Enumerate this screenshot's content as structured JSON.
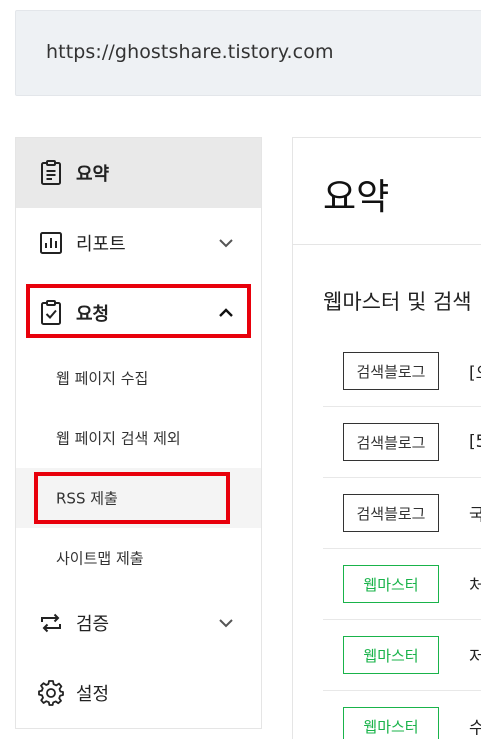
{
  "url_bar": {
    "url": "https://ghostshare.tistory.com"
  },
  "sidebar": {
    "items": [
      {
        "label": "요약",
        "icon": "clipboard-icon",
        "active": true
      },
      {
        "label": "리포트",
        "icon": "bar-chart-icon",
        "expanded": false
      },
      {
        "label": "요청",
        "icon": "clipboard-check-icon",
        "expanded": true,
        "children": [
          {
            "label": "웹 페이지 수집"
          },
          {
            "label": "웹 페이지 검색 제외"
          },
          {
            "label": "RSS 제출",
            "selected": true
          },
          {
            "label": "사이트맵 제출"
          }
        ]
      },
      {
        "label": "검증",
        "icon": "swap-arrows-icon",
        "expanded": false
      },
      {
        "label": "설정",
        "icon": "gear-icon"
      }
    ]
  },
  "main": {
    "title": "요약",
    "section_title": "웹마스터 및 검색",
    "rows": [
      {
        "tag": "검색블로그",
        "tag_color": "#333333",
        "text": "[오"
      },
      {
        "tag": "검색블로그",
        "tag_color": "#333333",
        "text": "[5"
      },
      {
        "tag": "검색블로그",
        "tag_color": "#333333",
        "text": "국"
      },
      {
        "tag": "웹마스터",
        "tag_color": "#19b34a",
        "text": "처"
      },
      {
        "tag": "웹마스터",
        "tag_color": "#19b34a",
        "text": "저"
      },
      {
        "tag": "웹마스터",
        "tag_color": "#19b34a",
        "text": "수"
      }
    ]
  },
  "colors": {
    "highlight": "#e8000b",
    "accent_green": "#19b34a"
  }
}
